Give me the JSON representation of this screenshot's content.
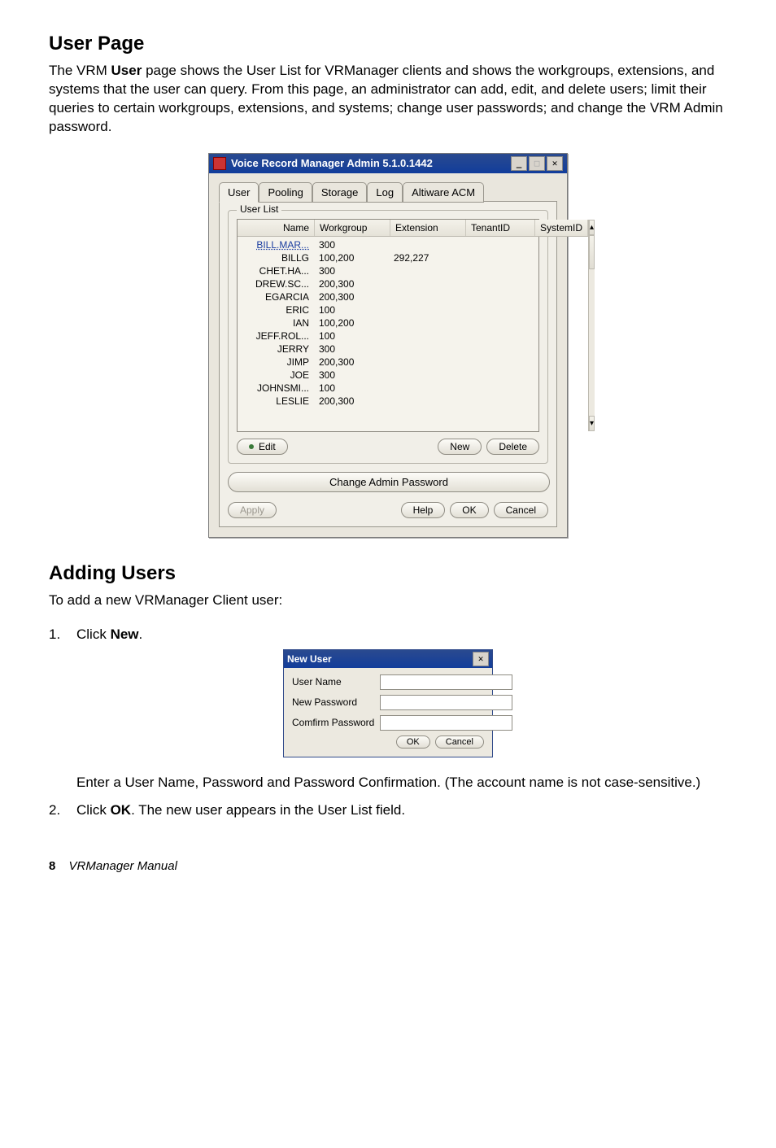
{
  "section1": {
    "title": "User Page",
    "para1_prefix": "The VRM ",
    "para1_bold": "User",
    "para1_suffix": " page shows the User List for VRManager clients and shows the workgroups, extensions, and systems that the user can query. From this page, an administrator can add, edit, and delete users; limit their queries to certain workgroups, extensions, and systems; change user passwords; and change the VRM Admin password."
  },
  "window": {
    "title": "Voice Record Manager Admin 5.1.0.1442",
    "tabs": {
      "user": "User",
      "pooling": "Pooling",
      "storage": "Storage",
      "log": "Log",
      "altiware": "Altiware ACM"
    },
    "userlist_legend": "User List",
    "columns": {
      "name": "Name",
      "workgroup": "Workgroup",
      "extension": "Extension",
      "tenantid": "TenantID",
      "systemid": "SystemID"
    },
    "rows": [
      {
        "name": "BILL.MAR...",
        "workgroup": "300",
        "extension": ""
      },
      {
        "name": "BILLG",
        "workgroup": "100,200",
        "extension": "292,227"
      },
      {
        "name": "CHET.HA...",
        "workgroup": "300",
        "extension": ""
      },
      {
        "name": "DREW.SC...",
        "workgroup": "200,300",
        "extension": ""
      },
      {
        "name": "EGARCIA",
        "workgroup": "200,300",
        "extension": ""
      },
      {
        "name": "ERIC",
        "workgroup": "100",
        "extension": ""
      },
      {
        "name": "IAN",
        "workgroup": "100,200",
        "extension": ""
      },
      {
        "name": "JEFF.ROL...",
        "workgroup": "100",
        "extension": ""
      },
      {
        "name": "JERRY",
        "workgroup": "300",
        "extension": ""
      },
      {
        "name": "JIMP",
        "workgroup": "200,300",
        "extension": ""
      },
      {
        "name": "JOE",
        "workgroup": "300",
        "extension": ""
      },
      {
        "name": "JOHNSMI...",
        "workgroup": "100",
        "extension": ""
      },
      {
        "name": "LESLIE",
        "workgroup": "200,300",
        "extension": ""
      }
    ],
    "buttons": {
      "edit": "Edit",
      "new": "New",
      "delete": "Delete",
      "change_pw": "Change Admin Password",
      "apply": "Apply",
      "help": "Help",
      "ok": "OK",
      "cancel": "Cancel"
    }
  },
  "section2": {
    "title": "Adding Users",
    "intro": "To add a new VRManager Client user:",
    "step1_num": "1.",
    "step1_prefix": "Click ",
    "step1_bold": "New",
    "step1_suffix": ".",
    "step1_para2": "Enter a User Name, Password and Password Confirmation. (The account name is not case-sensitive.)",
    "step2_num": "2.",
    "step2_prefix": "Click ",
    "step2_bold": "OK",
    "step2_suffix": ". The new user appears in the User List field."
  },
  "dialog": {
    "title": "New User",
    "fields": {
      "username": "User Name",
      "newpw": "New Password",
      "confirm": "Comfirm Password"
    },
    "ok": "OK",
    "cancel": "Cancel"
  },
  "footer": {
    "page": "8",
    "manual": "VRManager Manual"
  }
}
